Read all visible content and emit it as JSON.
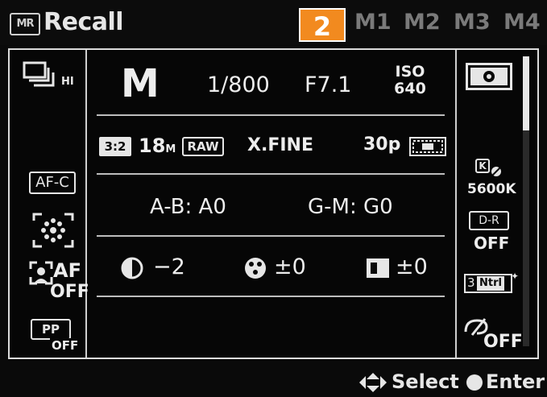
{
  "header": {
    "mode_icon": "MR",
    "title": "Recall",
    "tabs": [
      {
        "label": "2",
        "selected": true
      },
      {
        "label": "M1",
        "selected": false
      },
      {
        "label": "M2",
        "selected": false
      },
      {
        "label": "M3",
        "selected": false
      },
      {
        "label": "M4",
        "selected": false
      }
    ],
    "accent_color": "#f28a1f"
  },
  "left_column": {
    "drive_mode_icon": "continuous-hi-icon",
    "drive_mode_suffix": "HI",
    "focus_mode": "AF-C",
    "focus_area_icon": "focus-area-icon",
    "face_af_label": "AF",
    "face_af_value": "OFF",
    "picture_profile_label": "PP",
    "picture_profile_value": "OFF"
  },
  "center": {
    "row1": {
      "mode": "M",
      "shutter": "1/800",
      "aperture": "F7.1",
      "iso_label": "ISO",
      "iso_value": "640"
    },
    "row2": {
      "aspect": "3:2",
      "size": "18",
      "size_unit": "M",
      "raw": "RAW",
      "quality": "X.FINE",
      "movie_fps": "30p"
    },
    "row3": {
      "ab": "A-B: A0",
      "gm": "G-M: G0"
    },
    "row4": {
      "contrast": "−2",
      "saturation": "±0",
      "sharpness": "±0"
    }
  },
  "right_column": {
    "metering_icon": "metering-multi-icon",
    "wb_letter": "K",
    "wb_value": "5600K",
    "dro_label": "D-R",
    "dro_value": "OFF",
    "creative_number": "3",
    "creative_label": "Ntrl",
    "effect_value": "OFF"
  },
  "footer": {
    "select_label": "Select",
    "enter_label": "Enter"
  }
}
